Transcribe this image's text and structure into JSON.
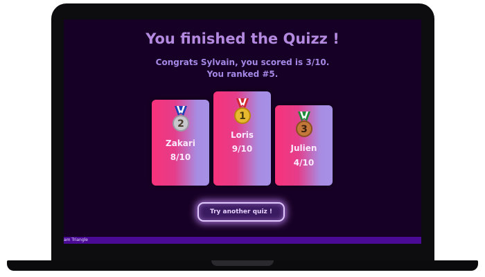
{
  "header": {
    "title": "You finished the Quizz !",
    "score_line": "Congrats Sylvain, you scored is 3/10.",
    "rank_line": "You ranked #5."
  },
  "podium": [
    {
      "rank": "2",
      "name": "Zakari",
      "score": "8/10",
      "medal": "silver-medal-icon"
    },
    {
      "rank": "1",
      "name": "Loris",
      "score": "9/10",
      "medal": "gold-medal-icon"
    },
    {
      "rank": "3",
      "name": "Julien",
      "score": "4/10",
      "medal": "bronze-medal-icon"
    }
  ],
  "actions": {
    "retry_label": "Try another quiz !"
  },
  "footer": {
    "text": "am Triangle"
  },
  "colors": {
    "background": "#170025",
    "title": "#b48ae0",
    "card_gradient_start": "#f8327a",
    "card_gradient_end": "#a591e6",
    "footer_bar": "#4a0a96",
    "gold": "#e7b92f",
    "silver": "#c7c7cc",
    "bronze": "#c3783a"
  }
}
